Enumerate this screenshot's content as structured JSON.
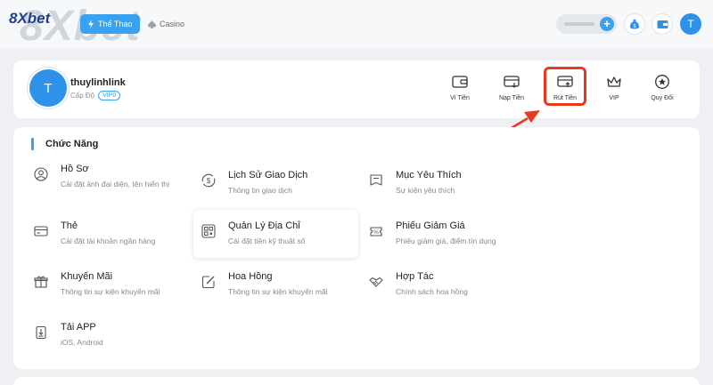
{
  "header": {
    "logo_watermark": "8Xbet",
    "logo_small": "8Xbet",
    "tabs": [
      {
        "label": "Thể Thao",
        "icon": "lightning-icon",
        "active": true
      },
      {
        "label": "Casino",
        "icon": "spade-icon",
        "active": false
      }
    ],
    "user_initial": "T"
  },
  "profile": {
    "initial": "T",
    "username": "thuylinhlink",
    "level_label": "Cấp Độ",
    "level_value": "VIP0",
    "actions": [
      {
        "label": "Ví Tiền",
        "icon": "wallet-icon"
      },
      {
        "label": "Nạp Tiền",
        "icon": "deposit-icon"
      },
      {
        "label": "Rút Tiền",
        "icon": "withdraw-icon",
        "highlighted": true
      },
      {
        "label": "VIP",
        "icon": "crown-icon"
      },
      {
        "label": "Quy Đổi",
        "icon": "exchange-icon"
      }
    ]
  },
  "functions": {
    "title": "Chức Năng",
    "items": [
      {
        "title": "Hồ Sơ",
        "desc": "Cài đặt ảnh đại diện, tên hiển thị",
        "icon": "user-icon"
      },
      {
        "title": "Lịch Sử Giao Dịch",
        "desc": "Thông tin giao dịch",
        "icon": "dollar-cycle-icon"
      },
      {
        "title": "Mục Yêu Thích",
        "desc": "Sự kiện yêu thích",
        "icon": "bookmark-icon"
      },
      {
        "title": "Thẻ",
        "desc": "Cài đặt tài khoản ngân hàng",
        "icon": "card-icon"
      },
      {
        "title": "Quản Lý Địa Chỉ",
        "desc": "Cài đặt tiền kỹ thuật số",
        "icon": "qr-icon"
      },
      {
        "title": "Phiếu Giảm Giá",
        "desc": "Phiếu giảm giá, điểm tín dụng",
        "icon": "coupon-icon"
      },
      {
        "title": "Khuyến Mãi",
        "desc": "Thông tin sự kiện khuyến mãi",
        "icon": "gift-icon"
      },
      {
        "title": "Hoa Hồng",
        "desc": "Thông tin sự kiện khuyến mãi",
        "icon": "edit-icon"
      },
      {
        "title": "Hợp Tác",
        "desc": "Chính sách hoa hồng",
        "icon": "handshake-icon"
      },
      {
        "title": "Tải APP",
        "desc": "iOS, Android",
        "icon": "download-icon"
      }
    ]
  },
  "colors": {
    "accent": "#3aa0f0",
    "highlight": "#e8391f"
  }
}
